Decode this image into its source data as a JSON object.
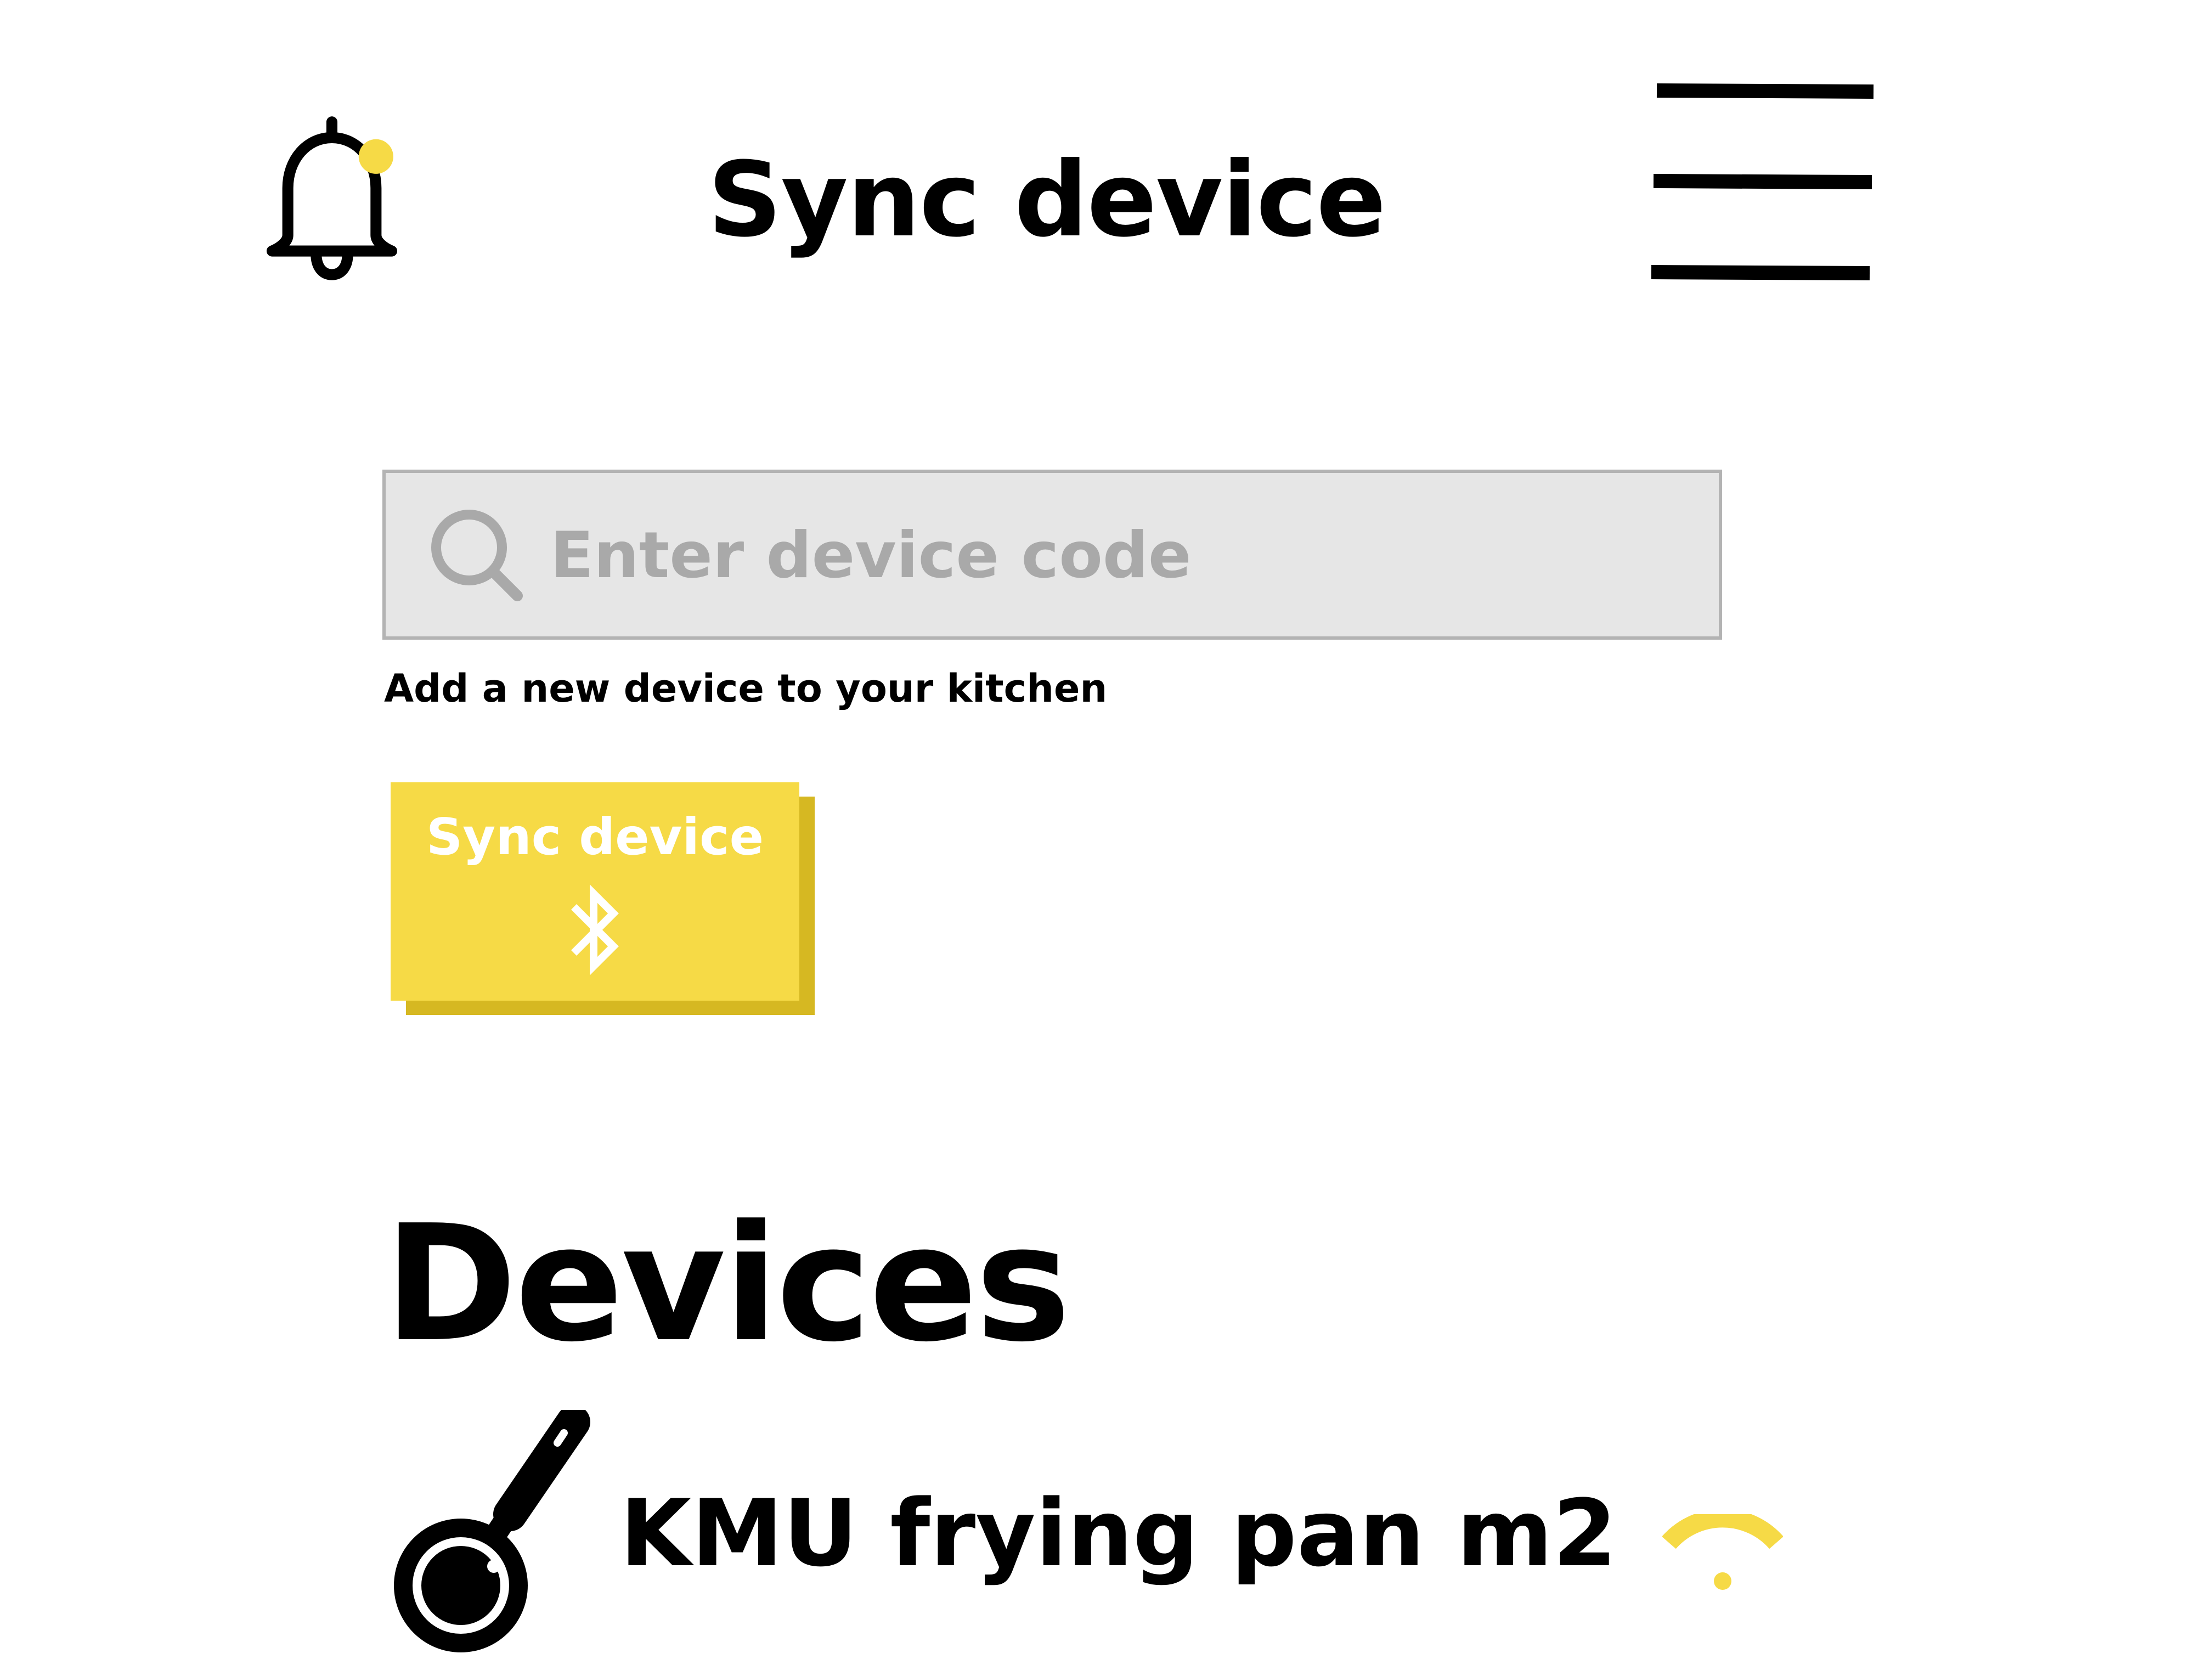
{
  "header": {
    "title": "Sync device",
    "notification_dot_color": "#f6da46",
    "bell_icon": "bell-icon",
    "menu_icon": "hamburger-menu-icon"
  },
  "search": {
    "placeholder": "Enter device code",
    "value": "",
    "icon": "search-icon",
    "helper_text": "Add a new device to your kitchen"
  },
  "sync_button": {
    "label": "Sync device",
    "icon": "bluetooth-icon",
    "color": "#f6da46",
    "shadow_color": "#d6b822"
  },
  "devices": {
    "heading": "Devices",
    "items": [
      {
        "name": "KMU frying pan m2",
        "icon": "frying-pan-icon",
        "status_icon": "wifi-icon",
        "status_color": "#f6da46"
      }
    ]
  }
}
